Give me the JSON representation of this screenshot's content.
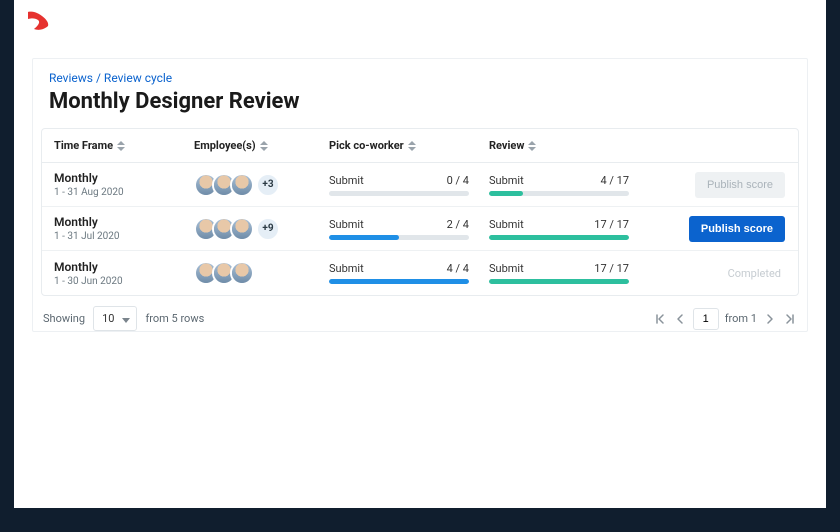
{
  "breadcrumb": {
    "root": "Reviews",
    "current": "Review cycle"
  },
  "page_title": "Monthly Designer Review",
  "columns": {
    "time_frame": "Time Frame",
    "employees": "Employee(s)",
    "pick_coworker": "Pick co-worker",
    "review": "Review"
  },
  "rows": [
    {
      "label": "Monthly",
      "range": "1 - 31 Aug 2020",
      "extra_count": "+3",
      "pick": {
        "label": "Submit",
        "count": "0 / 4",
        "pct": 0
      },
      "review": {
        "label": "Submit",
        "count": "4 / 17",
        "pct": 24
      },
      "action": {
        "type": "disabled",
        "text": "Publish score"
      }
    },
    {
      "label": "Monthly",
      "range": "1 - 31 Jul 2020",
      "extra_count": "+9",
      "pick": {
        "label": "Submit",
        "count": "2 / 4",
        "pct": 50
      },
      "review": {
        "label": "Submit",
        "count": "17 / 17",
        "pct": 100
      },
      "action": {
        "type": "primary",
        "text": "Publish score"
      }
    },
    {
      "label": "Monthly",
      "range": "1 - 30 Jun 2020",
      "extra_count": "",
      "pick": {
        "label": "Submit",
        "count": "4 / 4",
        "pct": 100
      },
      "review": {
        "label": "Submit",
        "count": "17 / 17",
        "pct": 100
      },
      "action": {
        "type": "completed",
        "text": "Completed"
      }
    }
  ],
  "pagination": {
    "showing_label": "Showing",
    "page_size": "10",
    "from_rows_label": "from 5 rows",
    "current_page": "1",
    "from_pages_label": "from 1"
  }
}
